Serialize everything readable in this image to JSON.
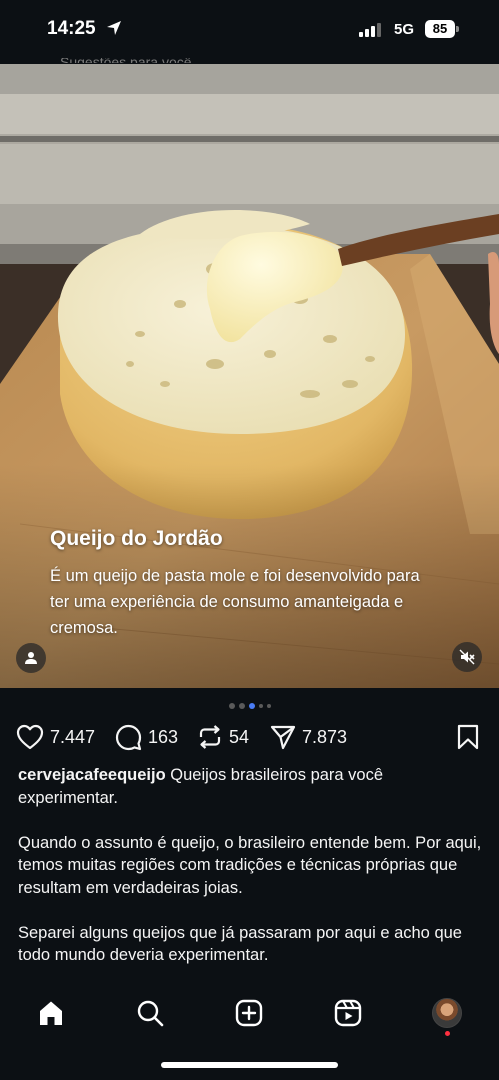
{
  "status_bar": {
    "time": "14:25",
    "network": "5G",
    "battery": "85"
  },
  "behind": {
    "label": "Sugestões para você"
  },
  "post": {
    "media": {
      "title": "Queijo do Jordão",
      "body": "É um queijo de pasta mole e foi desenvolvido para ter uma experiência de consumo amanteigada e cremosa.",
      "carousel": {
        "count": 5,
        "active_index": 2
      }
    },
    "actions": {
      "likes": "7.447",
      "comments": "163",
      "reposts": "54",
      "shares": "7.873"
    },
    "caption": {
      "username": "cervejacafeequeijo",
      "first_line": "Queijos brasileiros para você experimentar.",
      "paragraph_2": "Quando o assunto é queijo, o brasileiro entende bem. Por aqui, temos muitas regiões com tradições e técnicas próprias que resultam em verdadeiras joias.",
      "paragraph_3": "Separei alguns queijos que já passaram por aqui e acho que todo mundo deveria experimentar."
    }
  },
  "nav": {
    "items": [
      "home-icon",
      "search-icon",
      "create-icon",
      "reels-icon",
      "profile-avatar"
    ],
    "active": "home-icon"
  },
  "colors": {
    "background": "#0c1014",
    "active_dot": "#4a7cf5",
    "notification": "#ff3040"
  }
}
